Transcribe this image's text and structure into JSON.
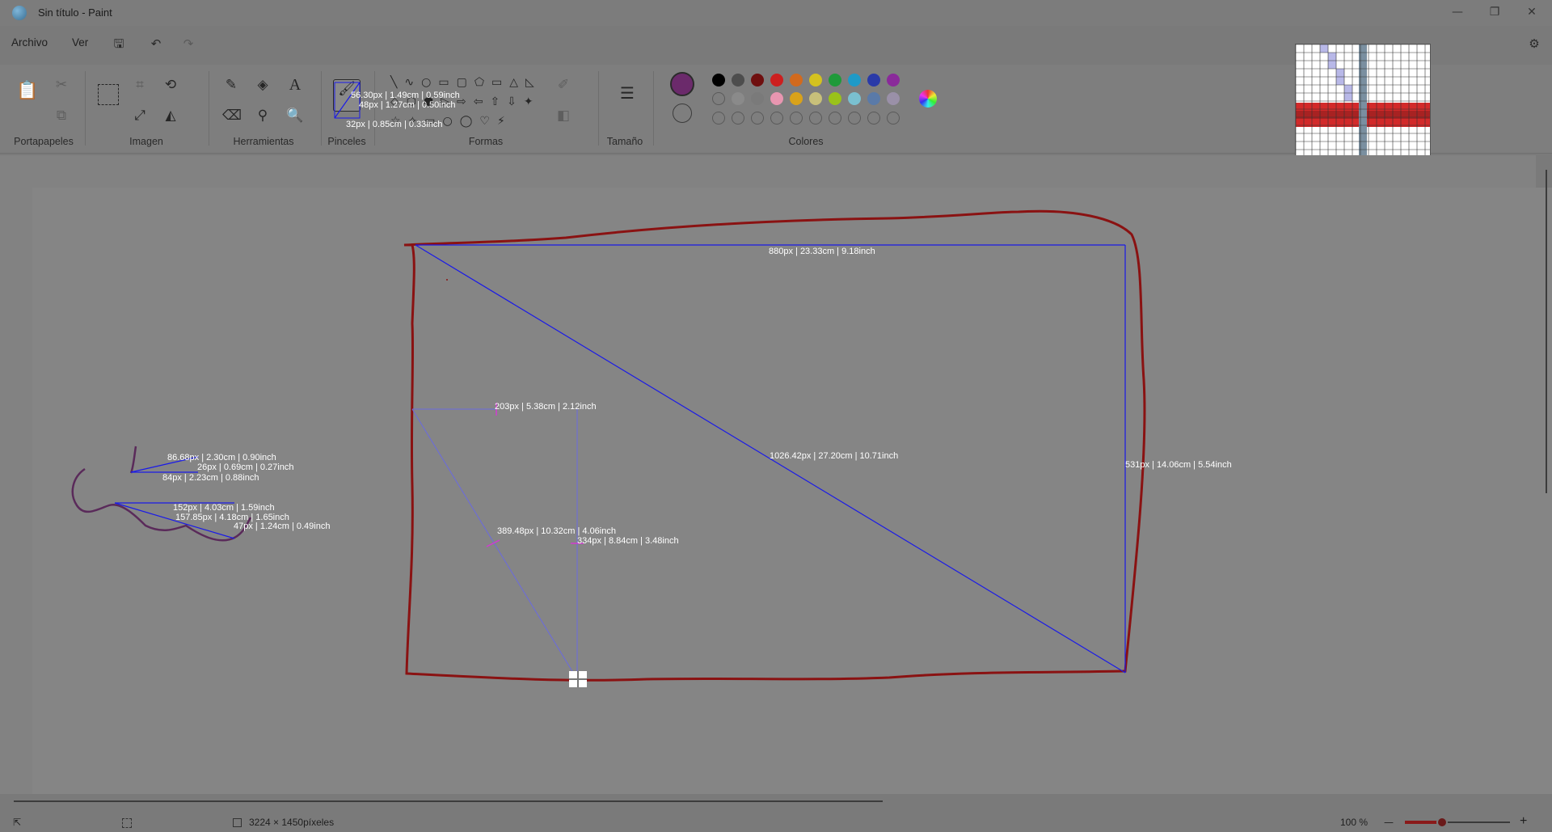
{
  "window": {
    "title": "Sin título - Paint",
    "min": "—",
    "max": "❐",
    "close": "✕"
  },
  "menu": {
    "file": "Archivo",
    "view": "Ver"
  },
  "ribbon": {
    "groups": [
      "Portapapeles",
      "Imagen",
      "Herramientas",
      "Pinceles",
      "Formas",
      "Tamaño",
      "Colores"
    ]
  },
  "colors": {
    "primary": "#6b2a6b",
    "palette_row1": [
      "#000000",
      "#4d4d4d",
      "#6f0f0f",
      "#cc1f1f",
      "#d26a1e",
      "#d4c21f",
      "#1f9a3a",
      "#1f9ac7",
      "#2a3aa8",
      "#8a2a9a"
    ],
    "palette_row2": [
      "",
      "#8a8a8a",
      "#7a7a7a",
      "#e896b0",
      "#d9a21a",
      "#c8c07a",
      "#9ac21a",
      "#7ac0d0",
      "#5a7aa8",
      "#9a90a8"
    ]
  },
  "measurements": {
    "brush_icon_1": "56.30px |   1.49cm |   0.59inch",
    "brush_icon_2": "48px |   1.27cm |   0.50inch",
    "brush_icon_3": "32px |   0.85cm |   0.33inch",
    "top": "880px |   23.33cm |   9.18inch",
    "diagonal": "1026.42px |   27.20cm |   10.71inch",
    "right": "531px |   14.06cm |   5.54inch",
    "inner_h": "203px |   5.38cm |   2.12inch",
    "inner_diag": "389.48px |   10.32cm |   4.06inch",
    "inner_v": "334px |   8.84cm |   3.48inch",
    "small_1": "86.68px |   2.30cm |   0.90inch",
    "small_2": "26px |   0.69cm |   0.27inch",
    "small_3": "84px |   2.23cm |   0.88inch",
    "small_4": "152px |   4.03cm |   1.59inch",
    "small_5": "157.85px |   4.18cm |   1.65inch",
    "small_6": "47px |   1.24cm |   0.49inch"
  },
  "status": {
    "canvas_size": "3224 × 1450píxeles",
    "zoom": "100 %",
    "zoom_level": 0.35
  }
}
